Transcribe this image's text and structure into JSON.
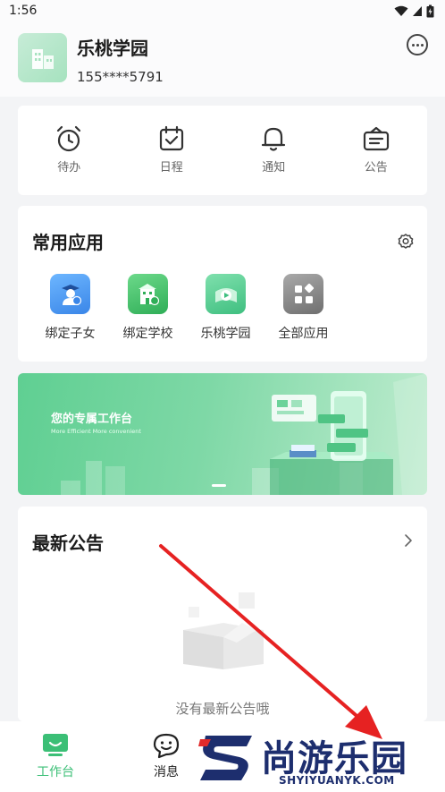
{
  "status_bar": {
    "time": "1:56"
  },
  "header": {
    "org_name": "乐桃学园",
    "phone": "155****5791"
  },
  "quick_actions": [
    {
      "label": "待办",
      "icon": "alarm-clock-icon"
    },
    {
      "label": "日程",
      "icon": "calendar-check-icon"
    },
    {
      "label": "通知",
      "icon": "bell-icon"
    },
    {
      "label": "公告",
      "icon": "announcement-icon"
    }
  ],
  "apps": {
    "title": "常用应用",
    "items": [
      {
        "label": "绑定子女",
        "icon": "student-link-icon",
        "color": "#4a9cf0"
      },
      {
        "label": "绑定学校",
        "icon": "school-link-icon",
        "color": "#3fbf6a"
      },
      {
        "label": "乐桃学园",
        "icon": "play-icon",
        "color": "#48c98a"
      },
      {
        "label": "全部应用",
        "icon": "grid-icon",
        "color": "#8a8a8a"
      }
    ]
  },
  "banner": {
    "title": "您的专属工作台",
    "subtitle": "More Efficient  More convenient"
  },
  "notice": {
    "title": "最新公告",
    "empty_text": "没有最新公告哦"
  },
  "tabbar": [
    {
      "label": "工作台",
      "icon": "workbench-icon",
      "active": true
    },
    {
      "label": "消息",
      "icon": "message-icon",
      "active": false
    }
  ],
  "watermark": {
    "text": "尚游乐园",
    "sub": "SHYIYUANYK.COM"
  },
  "colors": {
    "accent": "#3bbf76",
    "arrow": "#e62222",
    "brand_navy": "#1d2e6e"
  }
}
